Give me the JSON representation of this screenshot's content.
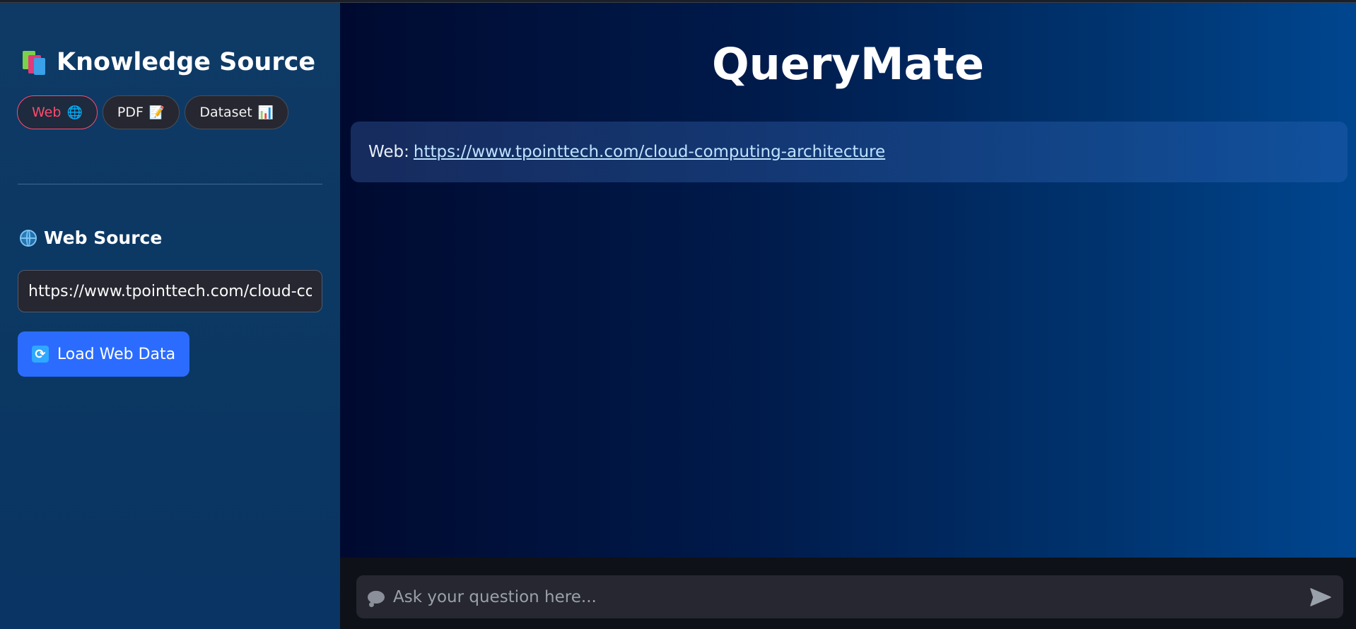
{
  "sidebar": {
    "title": "Knowledge Source",
    "title_icon": "books-icon",
    "source_tabs": [
      {
        "label": "Web",
        "icon": "globe-icon",
        "icon_glyph": "🌐",
        "active": true
      },
      {
        "label": "PDF",
        "icon": "memo-icon",
        "icon_glyph": "📝",
        "active": false
      },
      {
        "label": "Dataset",
        "icon": "bar-chart-icon",
        "icon_glyph": "📊",
        "active": false
      }
    ],
    "web_source": {
      "heading": "Web Source",
      "url_value": "https://www.tpointtech.com/cloud-computing-architecture",
      "load_button_label": "Load Web Data",
      "load_button_icon": "refresh-icon"
    }
  },
  "main": {
    "app_title": "QueryMate",
    "messages": [
      {
        "prefix": "Web:",
        "link": "https://www.tpointtech.com/cloud-computing-architecture"
      }
    ]
  },
  "chat": {
    "placeholder": "Ask your question here...",
    "input_icon": "speech-bubble-icon",
    "send_icon": "send-icon"
  },
  "colors": {
    "accent_active": "#ff4b6a",
    "button_primary": "#2b6cff",
    "sidebar_bg": "#0f3a66",
    "main_gradient_start": "#000a30",
    "main_gradient_end": "#00468f",
    "link": "#bfe3ff"
  }
}
